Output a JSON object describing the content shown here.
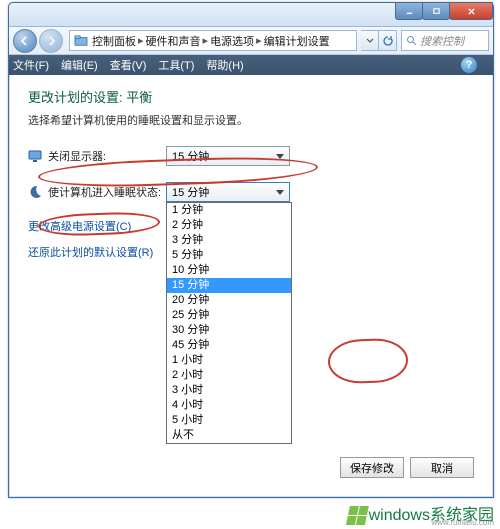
{
  "window": {
    "min_label": "minimize",
    "max_label": "maximize",
    "close_label": "close"
  },
  "nav": {
    "back_label": "back",
    "fwd_label": "forward"
  },
  "breadcrumb": {
    "root": "控制面板",
    "sep": "▸",
    "items": [
      "硬件和声音",
      "电源选项",
      "编辑计划设置"
    ]
  },
  "search": {
    "placeholder": "搜索控制"
  },
  "menu": {
    "items": [
      "文件(F)",
      "编辑(E)",
      "查看(V)",
      "工具(T)",
      "帮助(H)"
    ]
  },
  "page": {
    "title": "更改计划的设置: 平衡",
    "subtitle": "选择希望计算机使用的睡眠设置和显示设置。",
    "row_display": {
      "label": "关闭显示器:",
      "value": "15 分钟"
    },
    "row_sleep": {
      "label": "使计算机进入睡眠状态:",
      "value": "15 分钟"
    },
    "sleep_options": [
      "1 分钟",
      "2 分钟",
      "3 分钟",
      "5 分钟",
      "10 分钟",
      "15 分钟",
      "20 分钟",
      "25 分钟",
      "30 分钟",
      "45 分钟",
      "1 小时",
      "2 小时",
      "3 小时",
      "4 小时",
      "5 小时",
      "从不"
    ],
    "sleep_selected_index": 5,
    "link_adv": "更改高级电源设置(C)",
    "link_rest": "还原此计划的默认设置(R)",
    "btn_save": "保存修改",
    "btn_cancel": "取消"
  },
  "watermark": {
    "brand": "indows",
    "site": "www.ruihaifu.com",
    "tag": "系统家园"
  }
}
